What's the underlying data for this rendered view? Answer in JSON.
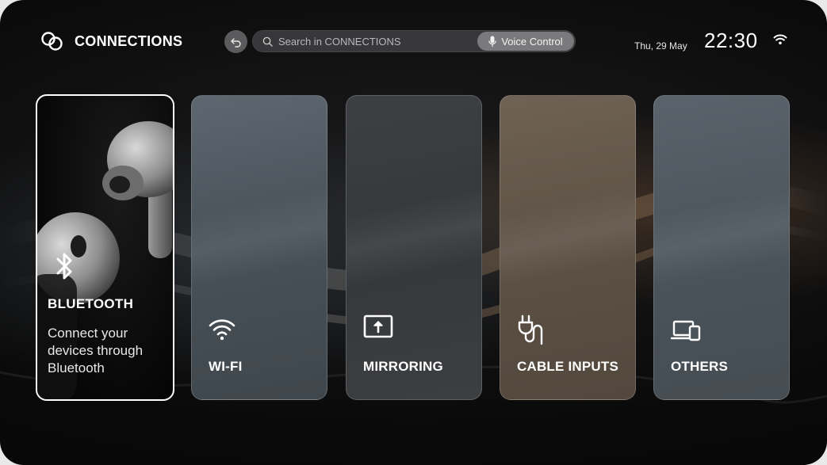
{
  "header": {
    "title": "CONNECTIONS",
    "brand_icon": "link-rings-icon",
    "back_icon": "back-arrow-icon"
  },
  "search": {
    "placeholder": "Search in CONNECTIONS",
    "icon": "search-icon",
    "voice_label": "Voice Control",
    "voice_icon": "microphone-icon"
  },
  "status": {
    "date": "Thu, 29 May",
    "time": "22:30",
    "wifi_icon": "wifi-icon"
  },
  "cards": {
    "bluetooth": {
      "label": "BLUETOOTH",
      "description": "Connect your devices through Bluetooth",
      "icon": "bluetooth-icon",
      "selected": true
    },
    "wifi": {
      "label": "WI-FI",
      "icon": "wifi-icon"
    },
    "mirroring": {
      "label": "MIRRORING",
      "icon": "screen-mirroring-icon"
    },
    "cable": {
      "label": "CABLE INPUTS",
      "icon": "plug-cable-icon"
    },
    "others": {
      "label": "OTHERS",
      "icon": "devices-icon"
    }
  },
  "colors": {
    "selected_border": "#ffffff",
    "text": "#ffffff"
  }
}
